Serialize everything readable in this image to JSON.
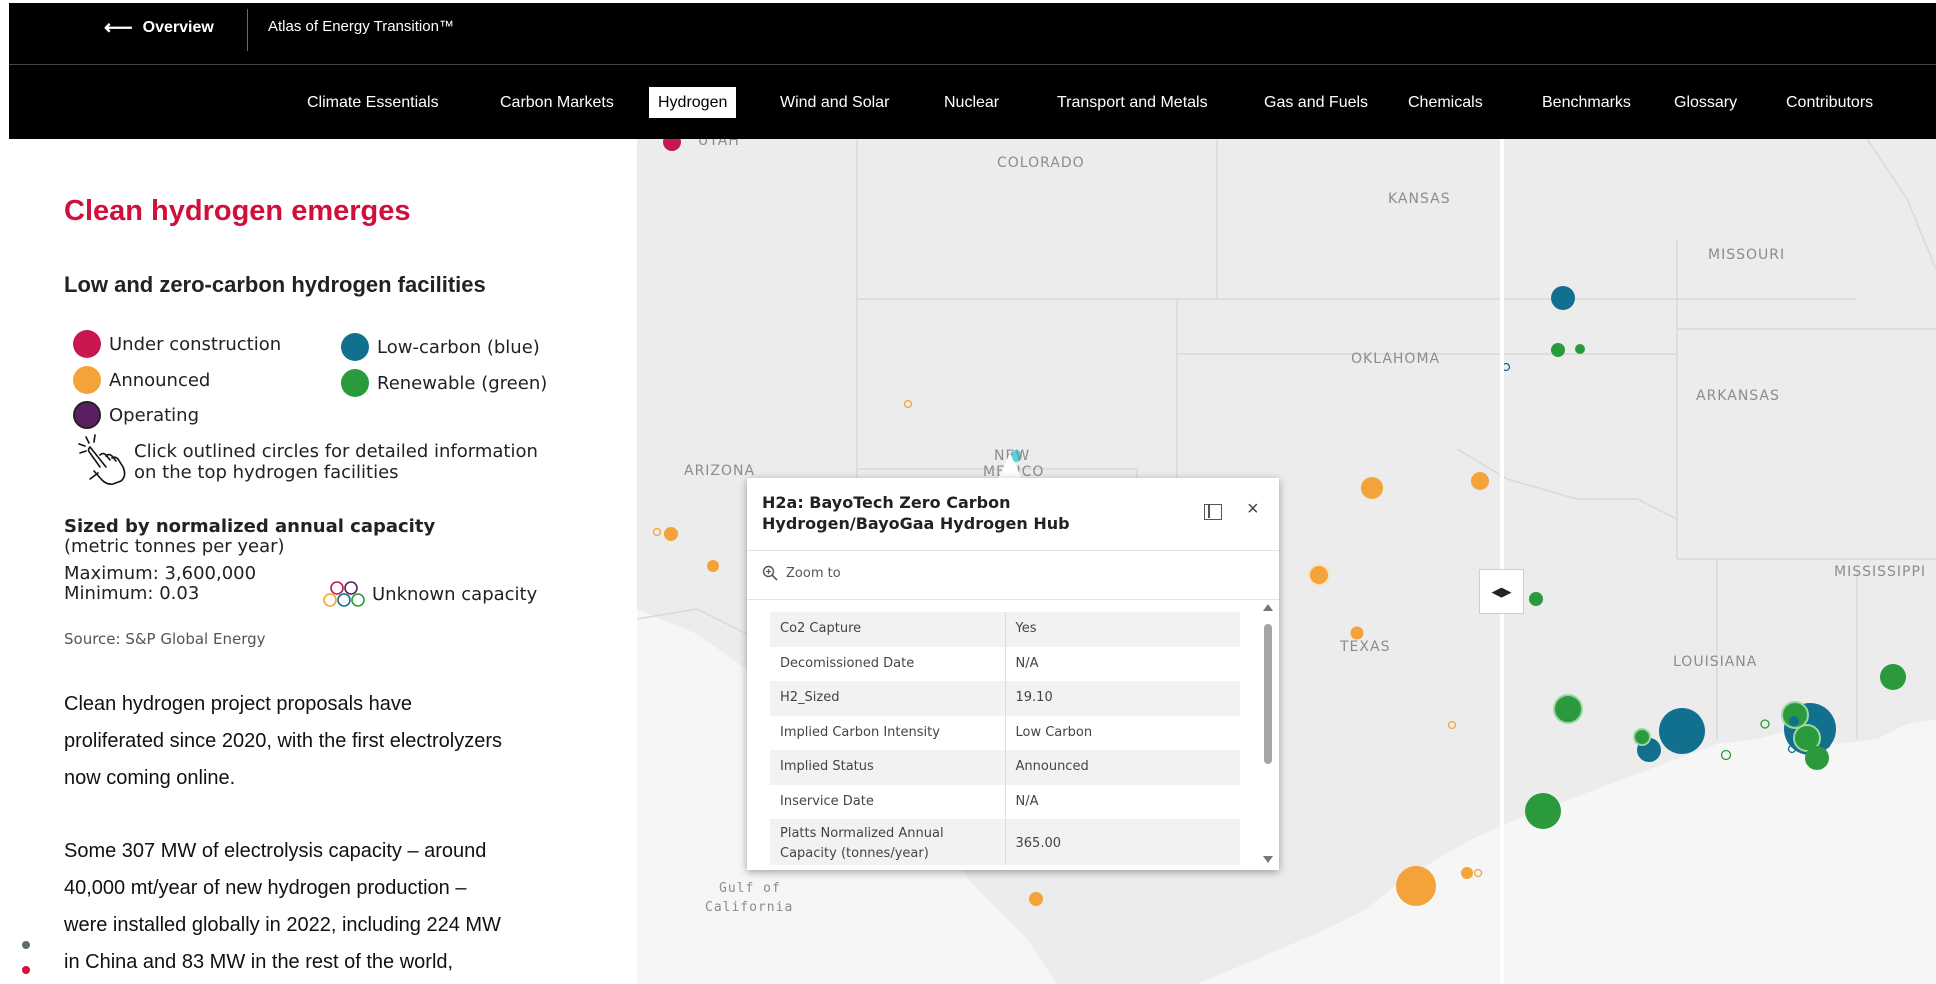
{
  "header": {
    "back_label": "Overview",
    "site_title": "Atlas of Energy Transition™"
  },
  "nav": {
    "items": [
      {
        "label": "Climate Essentials"
      },
      {
        "label": "Carbon Markets"
      },
      {
        "label": "Hydrogen",
        "active": true
      },
      {
        "label": "Wind and Solar"
      },
      {
        "label": "Nuclear"
      },
      {
        "label": "Transport and Metals"
      },
      {
        "label": "Gas and Fuels"
      },
      {
        "label": "Chemicals"
      },
      {
        "label": "Benchmarks"
      },
      {
        "label": "Glossary"
      },
      {
        "label": "Contributors"
      }
    ]
  },
  "story": {
    "title": "Clean hydrogen emerges",
    "legend": {
      "title": "Low and zero-carbon hydrogen facilities",
      "items": [
        {
          "label": "Under construction",
          "color": "#c8174e"
        },
        {
          "label": "Announced",
          "color": "#f3a33a"
        },
        {
          "label": "Operating",
          "color": "#5c1e63"
        },
        {
          "label": "Low-carbon (blue)",
          "color": "#12708f"
        },
        {
          "label": "Renewable (green)",
          "color": "#2a9a3c"
        }
      ],
      "hint_line1": "Click outlined circles for detailed information",
      "hint_line2": "on the top hydrogen facilities",
      "size_title": "Sized by normalized annual capacity",
      "size_unit": "(metric tonnes per year)",
      "maximum": "Maximum: 3,600,000",
      "minimum": "Minimum: 0.03",
      "unknown": "Unknown capacity",
      "source": "Source: S&P Global Energy"
    },
    "paragraph1": [
      "Clean hydrogen project proposals have",
      "proliferated since 2020, with the first electrolyzers",
      "now coming online."
    ],
    "paragraph2": [
      "Some 307 MW of electrolysis capacity – around",
      "40,000 mt/year of new hydrogen production –",
      "were installed globally in 2022, including 224 MW",
      "in China and 83 MW in the rest of the world,"
    ]
  },
  "map": {
    "state_labels": {
      "utah": "UTAH",
      "colorado": "COLORADO",
      "kansas": "KANSAS",
      "missouri": "MISSOURI",
      "oklahoma": "OKLAHOMA",
      "arkansas": "ARKANSAS",
      "arizona": "ARIZONA",
      "new_mexico_1": "NEW",
      "new_mexico_2": "MEXICO",
      "texas": "TEXAS",
      "louisiana": "LOUISIANA",
      "mississippi": "MISSISSIPPI"
    },
    "gulf_label_1": "Gulf of",
    "gulf_label_2": "California"
  },
  "popup": {
    "title": "H2a: BayoTech Zero Carbon Hydrogen/BayoGaa Hydrogen Hub",
    "zoom_to": "Zoom to",
    "rows": [
      {
        "field": "Co2 Capture",
        "value": "Yes"
      },
      {
        "field": "Decomissioned Date",
        "value": "N/A"
      },
      {
        "field": "H2_Sized",
        "value": "19.10"
      },
      {
        "field": "Implied Carbon Intensity",
        "value": "Low Carbon"
      },
      {
        "field": "Implied Status",
        "value": "Announced"
      },
      {
        "field": "Inservice Date",
        "value": "N/A"
      },
      {
        "field": "Platts Normalized Annual Capacity (tonnes/year)",
        "value": "365.00"
      }
    ]
  }
}
